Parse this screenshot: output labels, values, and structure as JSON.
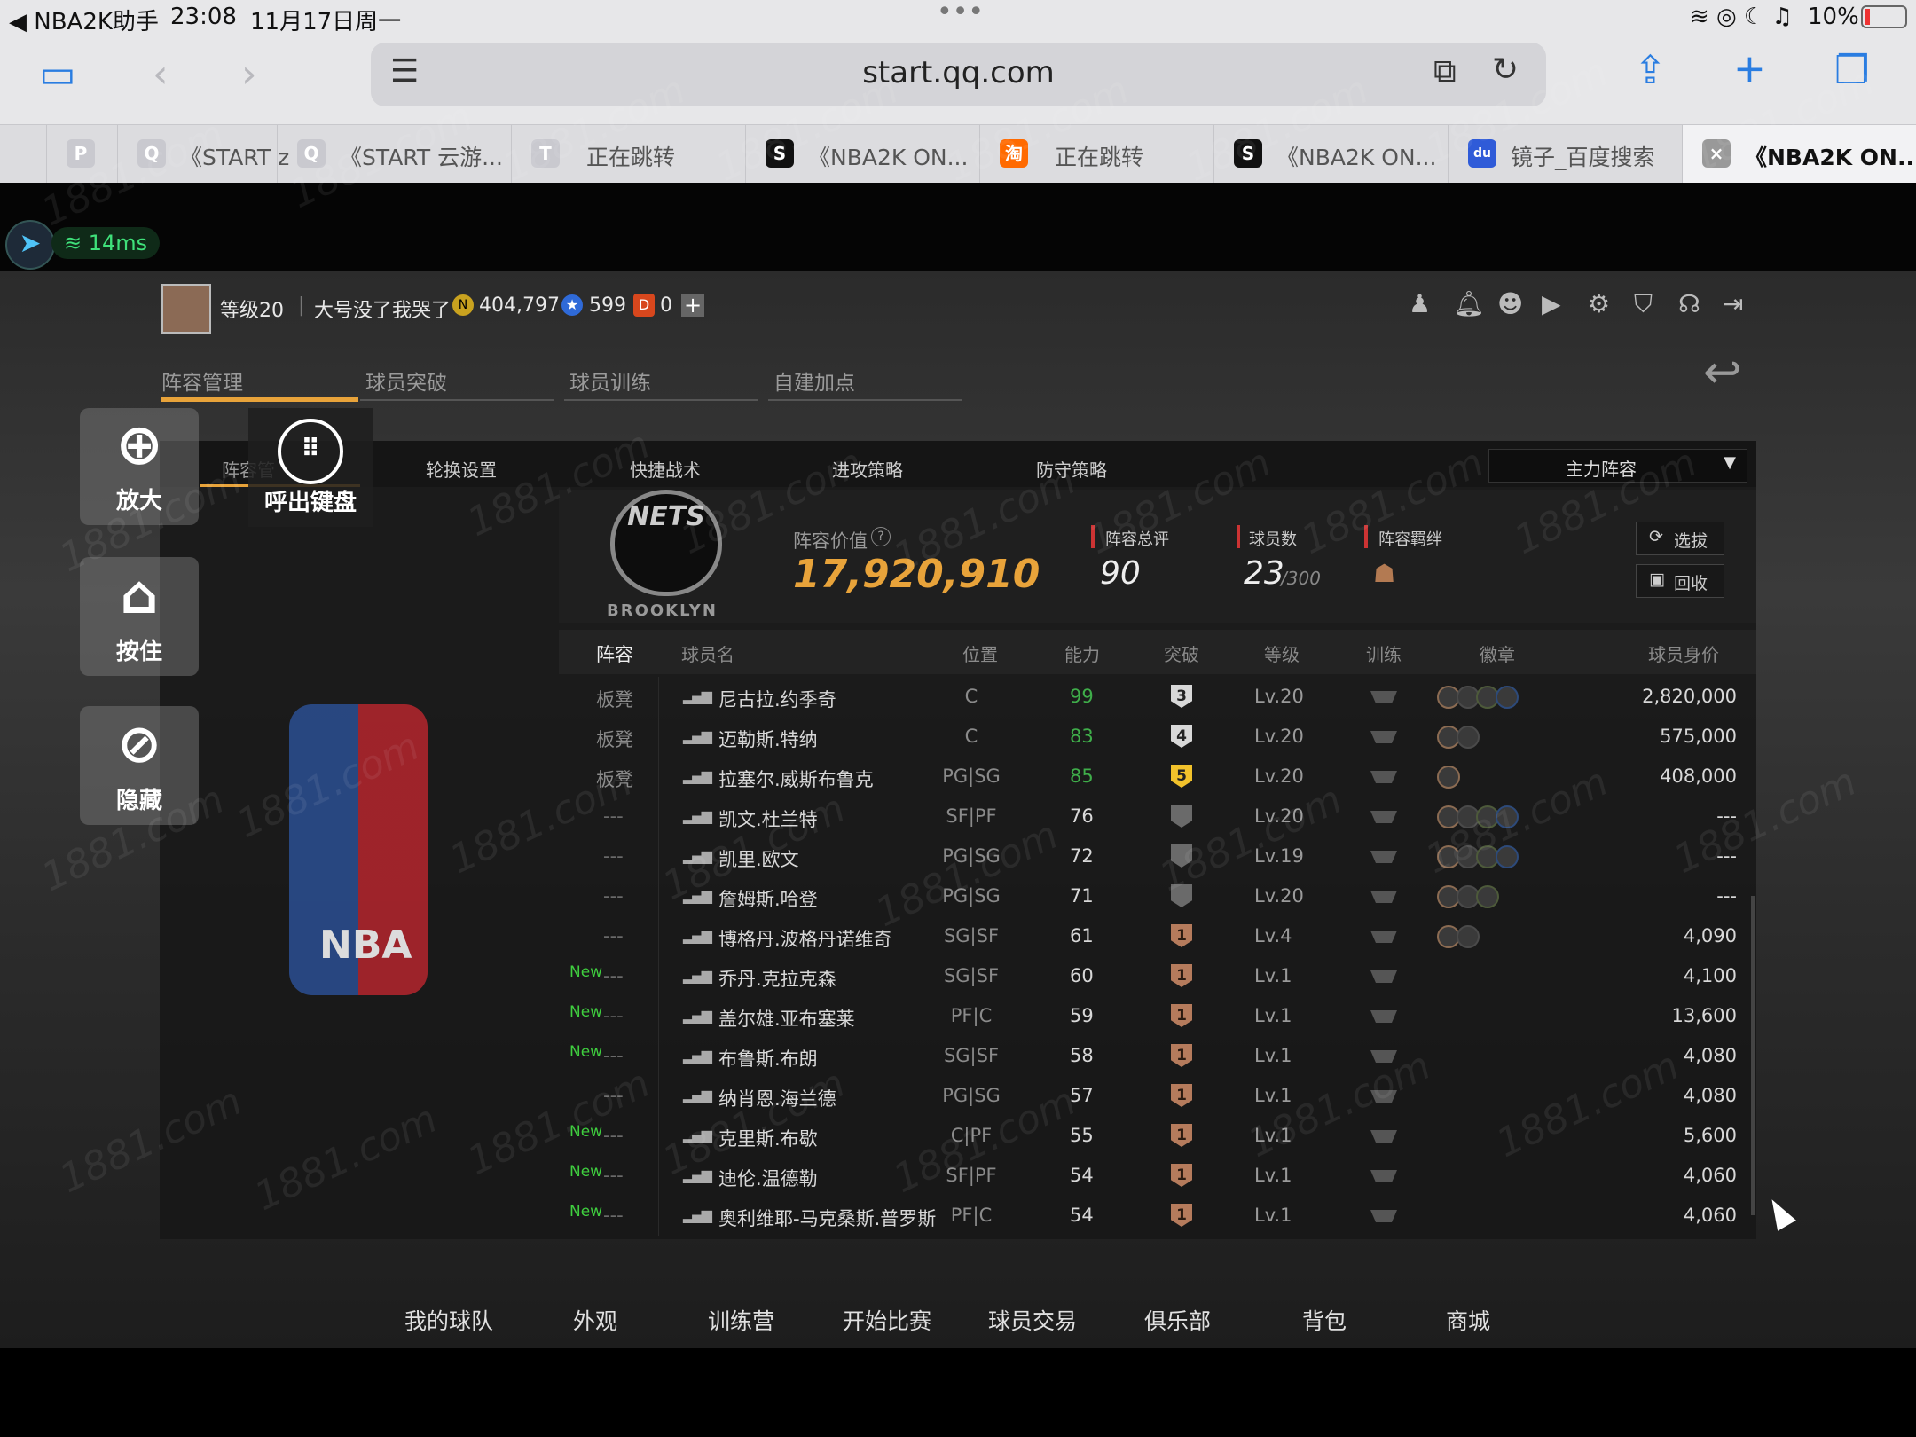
{
  "status": {
    "app": "◀ NBA2K助手",
    "time": "23:08",
    "date": "11月17日周一",
    "battery": "10%"
  },
  "safari": {
    "url": "start.qq.com"
  },
  "tabs": [
    {
      "fav": "P",
      "label": ""
    },
    {
      "fav": "Q",
      "label": "《START z"
    },
    {
      "fav": "Q",
      "label": "《START 云游..."
    },
    {
      "fav": "T",
      "label": "正在跳转"
    },
    {
      "fav": "S",
      "label": "《NBA2K ON..."
    },
    {
      "fav": "淘",
      "label": "正在跳转"
    },
    {
      "fav": "S",
      "label": "《NBA2K ON..."
    },
    {
      "fav": "du",
      "label": "镜子_百度搜索"
    },
    {
      "fav": "×",
      "label": "《NBA2K ON..."
    }
  ],
  "latency": "14ms",
  "player": {
    "level": "等级20",
    "name": "大号没了我哭了",
    "coins": "404,797",
    "stars": "599",
    "tickets": "0"
  },
  "main_tabs": [
    "阵容管理",
    "球员突破",
    "球员训练",
    "自建加点"
  ],
  "sub_tabs": [
    "阵容管",
    "轮换设置",
    "快捷战术",
    "进攻策略",
    "防守策略"
  ],
  "lineup_select": "主力阵容",
  "overlay": {
    "zoom": "放大",
    "keyboard": "呼出键盘",
    "hold": "按住",
    "hide": "隐藏"
  },
  "summary": {
    "value_label": "阵容价值",
    "value": "17,920,910",
    "rating_label": "阵容总评",
    "rating": "90",
    "count_label": "球员数",
    "count": "23",
    "count_max": "/300",
    "bond_label": "阵容羁绊",
    "pick_btn": "选拔",
    "recycle_btn": "回收"
  },
  "team_logo_text": "NETS",
  "team_logo_sub": "BROOKLYN",
  "nba_logo_text": "NBA",
  "table": {
    "headers": [
      "阵容",
      "球员名",
      "位置",
      "能力",
      "突破",
      "等级",
      "训练",
      "徽章",
      "球员身价"
    ],
    "rows": [
      {
        "role": "板凳",
        "new": "",
        "name": "尼古拉.约季奇",
        "pos": "C",
        "ovr": "99",
        "brk": "3",
        "lvl": "Lv.20",
        "price": "2,820,000"
      },
      {
        "role": "板凳",
        "new": "",
        "name": "迈勒斯.特纳",
        "pos": "C",
        "ovr": "83",
        "brk": "4",
        "lvl": "Lv.20",
        "price": "575,000"
      },
      {
        "role": "板凳",
        "new": "",
        "name": "拉塞尔.威斯布鲁克",
        "pos": "PG|SG",
        "ovr": "85",
        "brk": "5",
        "lvl": "Lv.20",
        "price": "408,000"
      },
      {
        "role": "---",
        "new": "",
        "name": "凯文.杜兰特",
        "pos": "SF|PF",
        "ovr": "76",
        "brk": "",
        "lvl": "Lv.20",
        "price": "---"
      },
      {
        "role": "---",
        "new": "",
        "name": "凯里.欧文",
        "pos": "PG|SG",
        "ovr": "72",
        "brk": "",
        "lvl": "Lv.19",
        "price": "---"
      },
      {
        "role": "---",
        "new": "",
        "name": "詹姆斯.哈登",
        "pos": "PG|SG",
        "ovr": "71",
        "brk": "",
        "lvl": "Lv.20",
        "price": "---"
      },
      {
        "role": "---",
        "new": "",
        "name": "博格丹.波格丹诺维奇",
        "pos": "SG|SF",
        "ovr": "61",
        "brk": "1",
        "lvl": "Lv.4",
        "price": "4,090"
      },
      {
        "role": "---",
        "new": "New",
        "name": "乔丹.克拉克森",
        "pos": "SG|SF",
        "ovr": "60",
        "brk": "1",
        "lvl": "Lv.1",
        "price": "4,100"
      },
      {
        "role": "---",
        "new": "New",
        "name": "盖尔雄.亚布塞莱",
        "pos": "PF|C",
        "ovr": "59",
        "brk": "1",
        "lvl": "Lv.1",
        "price": "13,600"
      },
      {
        "role": "---",
        "new": "New",
        "name": "布鲁斯.布朗",
        "pos": "SG|SF",
        "ovr": "58",
        "brk": "1",
        "lvl": "Lv.1",
        "price": "4,080"
      },
      {
        "role": "---",
        "new": "",
        "name": "纳肖恩.海兰德",
        "pos": "PG|SG",
        "ovr": "57",
        "brk": "1",
        "lvl": "Lv.1",
        "price": "4,080"
      },
      {
        "role": "---",
        "new": "New",
        "name": "克里斯.布歇",
        "pos": "C|PF",
        "ovr": "55",
        "brk": "1",
        "lvl": "Lv.1",
        "price": "5,600"
      },
      {
        "role": "---",
        "new": "New",
        "name": "迪伦.温德勒",
        "pos": "SF|PF",
        "ovr": "54",
        "brk": "1",
        "lvl": "Lv.1",
        "price": "4,060"
      },
      {
        "role": "---",
        "new": "New",
        "name": "奥利维耶-马克桑斯.普罗斯",
        "pos": "PF|C",
        "ovr": "54",
        "brk": "1",
        "lvl": "Lv.1",
        "price": "4,060"
      }
    ]
  },
  "bottom_nav": [
    "我的球队",
    "外观",
    "训练营",
    "开始比赛",
    "球员交易",
    "俱乐部",
    "背包",
    "商城"
  ],
  "watermark": "1881.com",
  "colors": {
    "accent": "#e8a33a",
    "green": "#3fae4a",
    "panel": "#161616"
  }
}
